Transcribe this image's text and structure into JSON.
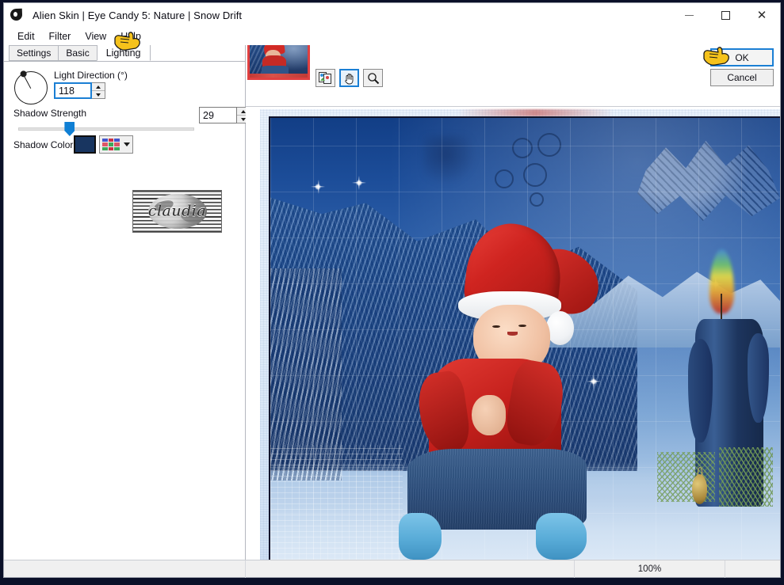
{
  "window": {
    "title": "Alien Skin | Eye Candy 5: Nature | Snow Drift",
    "icon": "alien-skin-drop-icon",
    "controls": {
      "minimize": "—",
      "maximize": "□",
      "close": "✕"
    }
  },
  "menubar": {
    "items": [
      {
        "label": "Edit"
      },
      {
        "label": "Filter"
      },
      {
        "label": "View"
      },
      {
        "label": "Help"
      }
    ]
  },
  "tabs": [
    {
      "label": "Settings",
      "active": false
    },
    {
      "label": "Basic",
      "active": false
    },
    {
      "label": "Lighting",
      "active": true
    }
  ],
  "controls": {
    "light_direction": {
      "label": "Light Direction (°)",
      "value": "118",
      "unit": "degrees",
      "dial_angle": 118
    },
    "shadow_strength": {
      "label": "Shadow Strength",
      "value": "29",
      "slider_percent": 29,
      "min": 0,
      "max": 100
    },
    "shadow_color": {
      "label": "Shadow Color",
      "swatch_hex": "#183560",
      "palette_colors": [
        "#4455cc",
        "#cc3344",
        "#4455cc",
        "#dd5566",
        "#3fa85a",
        "#dd5566",
        "#3fa85a",
        "#cc3344",
        "#3fa85a"
      ]
    }
  },
  "watermark": {
    "text": "claudia"
  },
  "preview": {
    "thumbnail_alt": "snow-drift-preview-thumbnail",
    "tools": [
      {
        "name": "compare-before-after-icon",
        "active": false
      },
      {
        "name": "hand-pan-icon",
        "active": true
      },
      {
        "name": "zoom-magnifier-icon",
        "active": false
      }
    ]
  },
  "dialog_buttons": {
    "ok": "OK",
    "cancel": "Cancel"
  },
  "statusbar": {
    "left": "",
    "middle": "",
    "zoom": "100%",
    "end": ""
  },
  "colors": {
    "accent": "#1b7fd4",
    "shadow": "#183560",
    "thumb_border": "#e04040",
    "hand_cursor": "#f5c21b"
  }
}
